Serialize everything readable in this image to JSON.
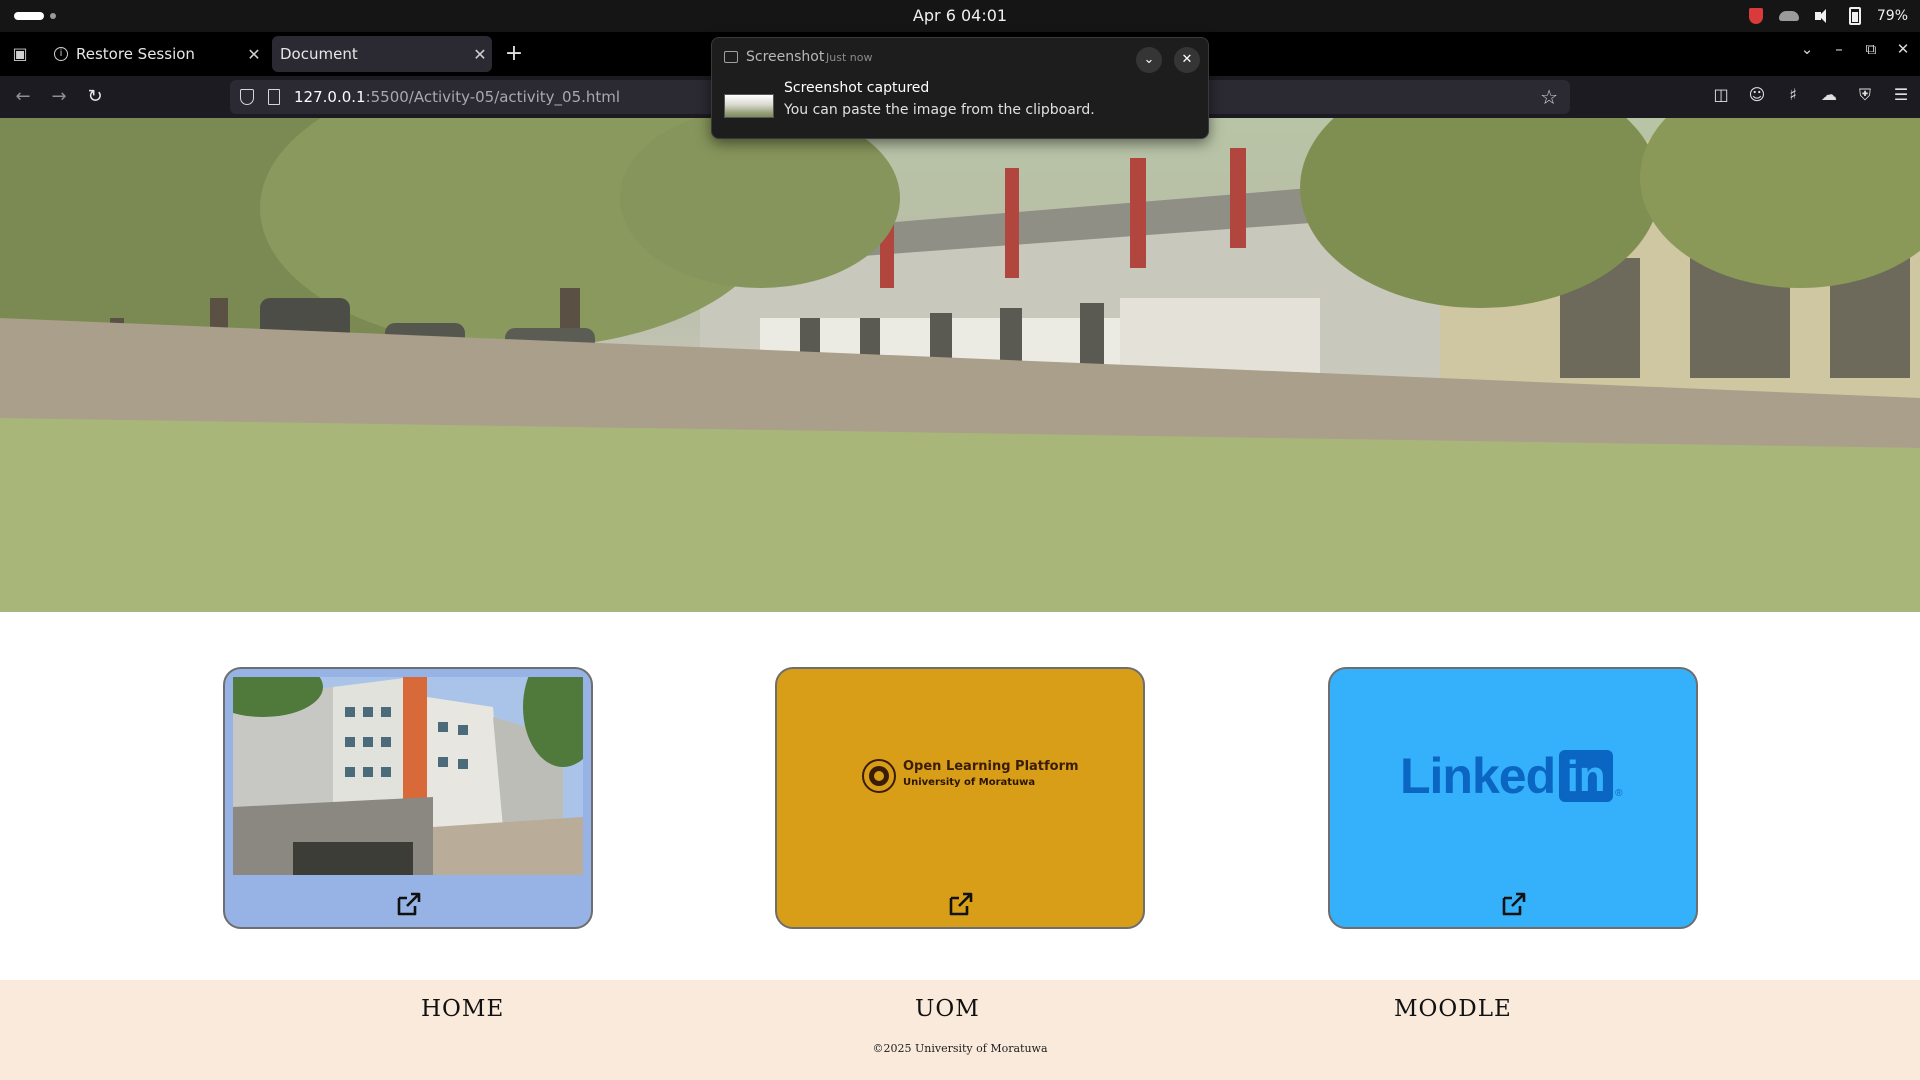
{
  "os_bar": {
    "datetime": "Apr 6  04:01",
    "battery": "79%"
  },
  "browser": {
    "tabs": [
      {
        "title": "Restore Session",
        "active": false
      },
      {
        "title": "Document",
        "active": true
      }
    ],
    "url_host": "127.0.0.1",
    "url_path": ":5500/Activity-05/activity_05.html"
  },
  "notification": {
    "app": "Screenshot",
    "time": "Just now",
    "title": "Screenshot captured",
    "body": "You can paste the image from the clipboard."
  },
  "page": {
    "hero_alt": "campus building",
    "cards": [
      {
        "name": "home",
        "background": "#97b3e6"
      },
      {
        "name": "uom",
        "background": "#d89e18",
        "logo_title": "Open Learning Platform",
        "logo_subtitle": "University of Moratuwa"
      },
      {
        "name": "moodle",
        "background": "#35b0fb",
        "logo_word": "Linked",
        "logo_box": "in",
        "logo_mark": "®"
      }
    ],
    "footer": {
      "links": [
        "HOME",
        "UOM",
        "MOODLE"
      ],
      "copyright": "©2025 University of Moratuwa",
      "background": "#faeadb"
    }
  }
}
